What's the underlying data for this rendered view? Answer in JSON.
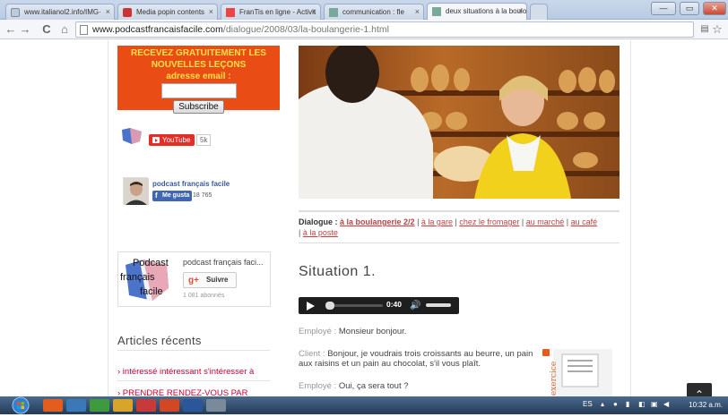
{
  "browser": {
    "tabs": [
      {
        "label": "www.italianol2.info/IMG·",
        "active": false
      },
      {
        "label": "Media popin contents",
        "active": false
      },
      {
        "label": "FranTis en ligne - Activit",
        "active": false
      },
      {
        "label": "communication : fle",
        "active": false
      },
      {
        "label": "deux situations à la boulo",
        "active": true
      }
    ],
    "url": "www.podcastfrancaisfacile.com/dialogue/2008/03/la-boulangerie-1.html",
    "url_host": "www.podcastfrancaisfacile.com",
    "url_path": "/dialogue/2008/03/la-boulangerie-1.html"
  },
  "sidebar": {
    "newsletter": {
      "line1": "RECEVEZ GRATUITEMENT LES",
      "line2": "NOUVELLES LEÇONS",
      "line3": "adresse email :",
      "email_value": "",
      "subscribe_label": "Subscribe"
    },
    "youtube": {
      "label": "YouTube",
      "count": "5k"
    },
    "facebook": {
      "name": "podcast français facile",
      "like_label": "Me gusta",
      "count": "18 765"
    },
    "gplus": {
      "name": "podcast français faci...",
      "follow_label": "Suivre",
      "followers": "1 081 abonnés"
    },
    "logo_words": [
      "Podcast",
      "français",
      "facile"
    ],
    "articles_title": "Articles récents",
    "articles": [
      "› intéressé intéressant s'intéresser à",
      "› PRENDRE RENDEZ-VOUS PAR"
    ]
  },
  "main": {
    "dialogue_nav": {
      "label": "Dialogue :",
      "links": [
        "à la boulangerie 2/2",
        "à la gare",
        "chez le fromager",
        "au marché",
        "au café",
        "à la poste"
      ]
    },
    "situation_title": "Situation 1.",
    "player": {
      "time": "0:40",
      "progress": 0.02
    },
    "dialogue_lines": [
      {
        "speaker": "Employé :",
        "text": "Monsieur bonjour."
      },
      {
        "speaker": "Client :",
        "text": "Bonjour, je voudrais trois croissants au beurre, un pain aux raisins et un pain au chocolat, s'il vous plaît."
      },
      {
        "speaker": "Employé :",
        "text": "Oui, ça sera tout ?"
      }
    ],
    "exercise_label": "exercice"
  },
  "taskbar": {
    "lang": "ES",
    "clock": "10:32 a.m."
  },
  "colors": {
    "orange": "#ea4c15",
    "link_red": "#c03",
    "player_bg": "#1e1e1e"
  }
}
